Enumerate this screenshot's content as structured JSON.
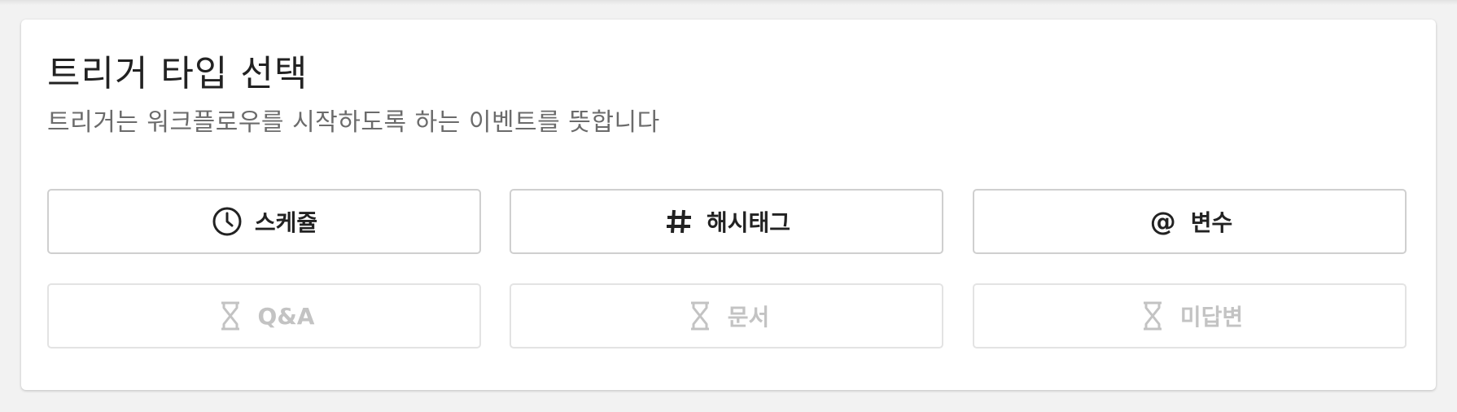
{
  "panel": {
    "title": "트리거 타입 선택",
    "subtitle": "트리거는 워크플로우를 시작하도록 하는 이벤트를 뜻합니다"
  },
  "trigger_types": [
    {
      "label": "스케쥴",
      "icon": "clock-icon",
      "enabled": true
    },
    {
      "label": "해시태그",
      "icon": "hash-icon",
      "enabled": true
    },
    {
      "label": "변수",
      "icon": "at-icon",
      "icon_glyph": "@",
      "enabled": true
    },
    {
      "label": "Q&A",
      "icon": "hourglass-icon",
      "enabled": false
    },
    {
      "label": "문서",
      "icon": "hourglass-icon",
      "enabled": false
    },
    {
      "label": "미답변",
      "icon": "hourglass-icon",
      "enabled": false
    }
  ],
  "colors": {
    "background": "#f2f2f2",
    "card": "#ffffff",
    "text_primary": "#222222",
    "text_secondary": "#6b6b6b",
    "disabled": "#c3c3c3"
  }
}
